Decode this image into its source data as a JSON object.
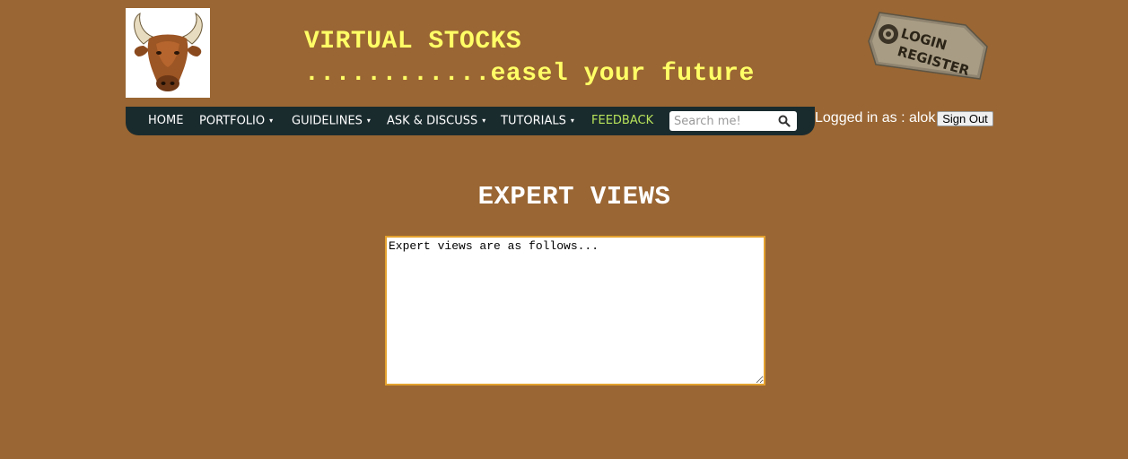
{
  "header": {
    "logo": "bull-head-logo",
    "title": "VIRTUAL STOCKS",
    "tagline": "............easel your future",
    "login_tag": {
      "login_label": "LOGIN",
      "register_label": "REGISTER"
    }
  },
  "nav": {
    "items": [
      {
        "label": "HOME",
        "has_dropdown": false
      },
      {
        "label": "PORTFOLIO",
        "has_dropdown": true
      },
      {
        "label": "GUIDELINES",
        "has_dropdown": true
      },
      {
        "label": "ASK & DISCUSS",
        "has_dropdown": true
      },
      {
        "label": "TUTORIALS",
        "has_dropdown": true
      },
      {
        "label": "FEEDBACK",
        "has_dropdown": false
      }
    ],
    "search": {
      "placeholder": "Search me!",
      "value": ""
    }
  },
  "user": {
    "logged_in_text": "Logged in as : alok",
    "signout_label": "Sign Out"
  },
  "main": {
    "heading": "EXPERT VIEWS",
    "textarea_value": "Expert views are as follows..."
  },
  "colors": {
    "background": "#9A6633",
    "title_yellow": "#FFFF66",
    "navbar": "#1A2B2E",
    "feedback_highlight": "#B8E35A",
    "textarea_border": "#E3A12E"
  }
}
